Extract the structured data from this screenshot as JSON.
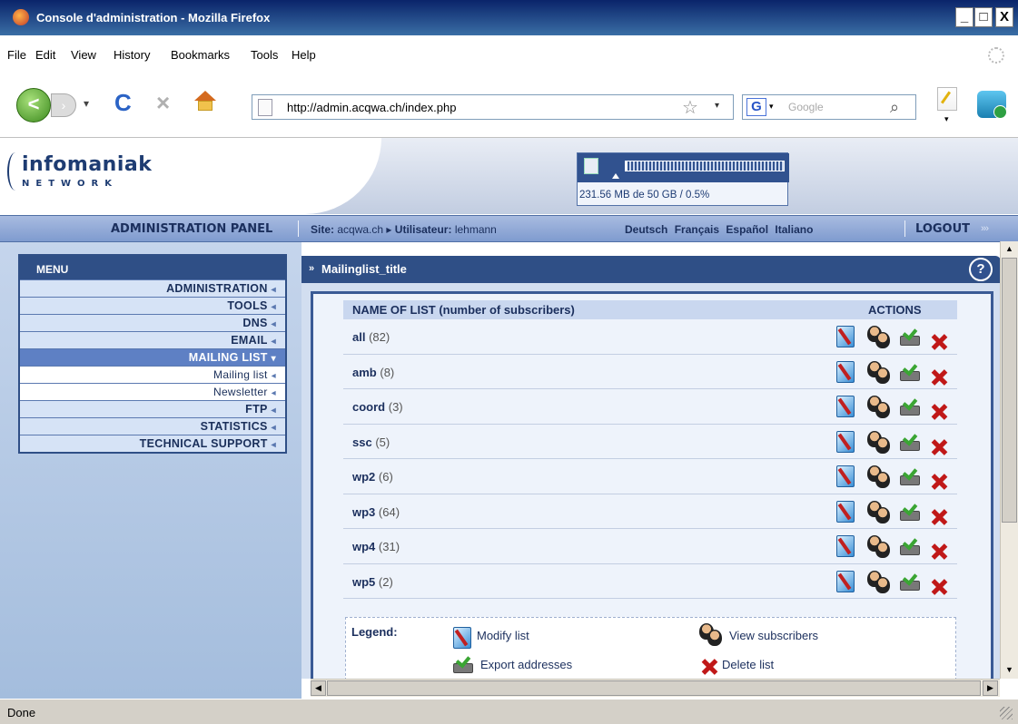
{
  "window": {
    "title": "Console d'administration - Mozilla Firefox",
    "minimize": "_",
    "maximize": "□",
    "close": "X"
  },
  "menubar": [
    "File",
    "Edit",
    "View",
    "History",
    "Bookmarks",
    "Tools",
    "Help"
  ],
  "toolbar": {
    "back": "<",
    "forward": "›",
    "history_dropdown": "▾",
    "reload": "C",
    "stop": "×",
    "url": "http://admin.acqwa.ch/index.php",
    "bookmark_star": "☆",
    "url_dropdown": "▾",
    "search_engine": "G",
    "search_engine_dropdown": "▾",
    "search_placeholder": "Google",
    "search_icon": "⌕",
    "notes_dropdown": "▾"
  },
  "header": {
    "logo_main": "infomaniak",
    "logo_sub": "NETWORK",
    "quota_text": "231.56 MB de 50 GB / 0.5%",
    "quota_percent": 0.5
  },
  "nav": {
    "panel_title": "ADMINISTRATION PANEL",
    "site_label": "Site:",
    "site_value": "acqwa.ch",
    "arrow": "▸",
    "user_label": "Utilisateur:",
    "user_value": "lehmann",
    "languages": [
      "Deutsch",
      "Français",
      "Español",
      "Italiano"
    ],
    "logout": "LOGOUT",
    "logout_arrows": "›››"
  },
  "sidebar": {
    "title": "MENU",
    "item_arrow": "◂",
    "active_arrow": "▾",
    "items": [
      {
        "label": "ADMINISTRATION",
        "type": "main"
      },
      {
        "label": "TOOLS",
        "type": "main"
      },
      {
        "label": "DNS",
        "type": "main"
      },
      {
        "label": "EMAIL",
        "type": "main"
      },
      {
        "label": "MAILING LIST",
        "type": "active"
      },
      {
        "label": "Mailing list",
        "type": "sub"
      },
      {
        "label": "Newsletter",
        "type": "sub"
      },
      {
        "label": "FTP",
        "type": "main"
      },
      {
        "label": "STATISTICS",
        "type": "main"
      },
      {
        "label": "TECHNICAL SUPPORT",
        "type": "main"
      }
    ]
  },
  "content": {
    "chevron": "»",
    "title": "Mailinglist_title",
    "help": "?",
    "col_name": "NAME OF LIST (number of subscribers)",
    "col_actions": "ACTIONS",
    "lists": [
      {
        "name": "all",
        "count": "(82)"
      },
      {
        "name": "amb",
        "count": "(8)"
      },
      {
        "name": "coord",
        "count": "(3)"
      },
      {
        "name": "ssc",
        "count": "(5)"
      },
      {
        "name": "wp2",
        "count": "(6)"
      },
      {
        "name": "wp3",
        "count": "(64)"
      },
      {
        "name": "wp4",
        "count": "(31)"
      },
      {
        "name": "wp5",
        "count": "(2)"
      }
    ],
    "legend_title": "Legend:",
    "legend": {
      "modify": "Modify list",
      "view": "View subscribers",
      "export": "Export addresses",
      "delete": "Delete list"
    }
  },
  "scroll": {
    "up": "▲",
    "down": "▼",
    "left": "◀",
    "right": "▶"
  },
  "status": {
    "text": "Done"
  }
}
